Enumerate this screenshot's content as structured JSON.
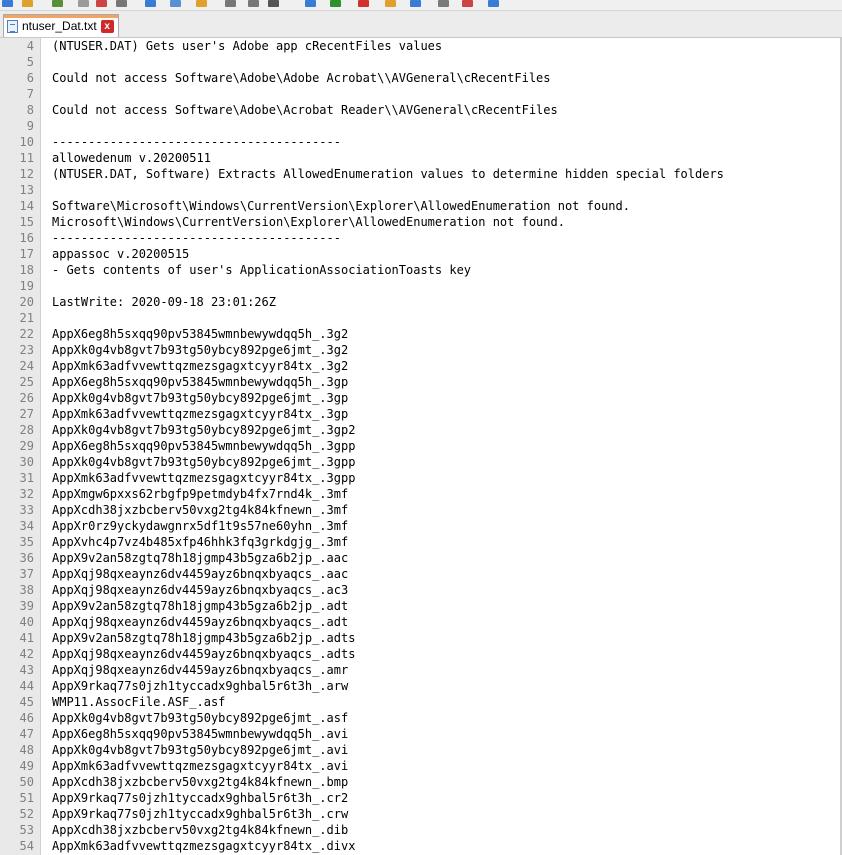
{
  "tab": {
    "label": "ntuser_Dat.txt",
    "close": "x"
  },
  "toolbar_icons": [
    "new-file-icon",
    "open-file-icon",
    "save-icon",
    "save-all-icon",
    "close-icon",
    "print-icon",
    "cut-icon",
    "copy-icon",
    "paste-icon",
    "undo-icon",
    "redo-icon",
    "find-icon",
    "replace-icon",
    "zoom-in-icon",
    "zoom-out-icon",
    "sync-icon",
    "wrap-icon",
    "indent-icon",
    "macro-record-icon",
    "macro-play-icon"
  ],
  "lines": [
    {
      "n": "4",
      "t": "(NTUSER.DAT) Gets user's Adobe app cRecentFiles values"
    },
    {
      "n": "5",
      "t": ""
    },
    {
      "n": "6",
      "t": "Could not access Software\\Adobe\\Adobe Acrobat\\\\AVGeneral\\cRecentFiles"
    },
    {
      "n": "7",
      "t": ""
    },
    {
      "n": "8",
      "t": "Could not access Software\\Adobe\\Acrobat Reader\\\\AVGeneral\\cRecentFiles"
    },
    {
      "n": "9",
      "t": ""
    },
    {
      "n": "10",
      "t": "----------------------------------------"
    },
    {
      "n": "11",
      "t": "allowedenum v.20200511"
    },
    {
      "n": "12",
      "t": "(NTUSER.DAT, Software) Extracts AllowedEnumeration values to determine hidden special folders"
    },
    {
      "n": "13",
      "t": ""
    },
    {
      "n": "14",
      "t": "Software\\Microsoft\\Windows\\CurrentVersion\\Explorer\\AllowedEnumeration not found."
    },
    {
      "n": "15",
      "t": "Microsoft\\Windows\\CurrentVersion\\Explorer\\AllowedEnumeration not found."
    },
    {
      "n": "16",
      "t": "----------------------------------------"
    },
    {
      "n": "17",
      "t": "appassoc v.20200515"
    },
    {
      "n": "18",
      "t": "- Gets contents of user's ApplicationAssociationToasts key"
    },
    {
      "n": "19",
      "t": ""
    },
    {
      "n": "20",
      "t": "LastWrite: 2020-09-18 23:01:26Z"
    },
    {
      "n": "21",
      "t": ""
    },
    {
      "n": "22",
      "t": "AppX6eg8h5sxqq90pv53845wmnbewywdqq5h_.3g2"
    },
    {
      "n": "23",
      "t": "AppXk0g4vb8gvt7b93tg50ybcy892pge6jmt_.3g2"
    },
    {
      "n": "24",
      "t": "AppXmk63adfvvewttqzmezsgagxtcyyr84tx_.3g2"
    },
    {
      "n": "25",
      "t": "AppX6eg8h5sxqq90pv53845wmnbewywdqq5h_.3gp"
    },
    {
      "n": "26",
      "t": "AppXk0g4vb8gvt7b93tg50ybcy892pge6jmt_.3gp"
    },
    {
      "n": "27",
      "t": "AppXmk63adfvvewttqzmezsgagxtcyyr84tx_.3gp"
    },
    {
      "n": "28",
      "t": "AppXk0g4vb8gvt7b93tg50ybcy892pge6jmt_.3gp2"
    },
    {
      "n": "29",
      "t": "AppX6eg8h5sxqq90pv53845wmnbewywdqq5h_.3gpp"
    },
    {
      "n": "30",
      "t": "AppXk0g4vb8gvt7b93tg50ybcy892pge6jmt_.3gpp"
    },
    {
      "n": "31",
      "t": "AppXmk63adfvvewttqzmezsgagxtcyyr84tx_.3gpp"
    },
    {
      "n": "32",
      "t": "AppXmgw6pxxs62rbgfp9petmdyb4fx7rnd4k_.3mf"
    },
    {
      "n": "33",
      "t": "AppXcdh38jxzbcberv50vxg2tg4k84kfnewn_.3mf"
    },
    {
      "n": "34",
      "t": "AppXr0rz9yckydawgnrx5df1t9s57ne60yhn_.3mf"
    },
    {
      "n": "35",
      "t": "AppXvhc4p7vz4b485xfp46hhk3fq3grkdgjg_.3mf"
    },
    {
      "n": "36",
      "t": "AppX9v2an58zgtq78h18jgmp43b5gza6b2jp_.aac"
    },
    {
      "n": "37",
      "t": "AppXqj98qxeaynz6dv4459ayz6bnqxbyaqcs_.aac"
    },
    {
      "n": "38",
      "t": "AppXqj98qxeaynz6dv4459ayz6bnqxbyaqcs_.ac3"
    },
    {
      "n": "39",
      "t": "AppX9v2an58zgtq78h18jgmp43b5gza6b2jp_.adt"
    },
    {
      "n": "40",
      "t": "AppXqj98qxeaynz6dv4459ayz6bnqxbyaqcs_.adt"
    },
    {
      "n": "41",
      "t": "AppX9v2an58zgtq78h18jgmp43b5gza6b2jp_.adts"
    },
    {
      "n": "42",
      "t": "AppXqj98qxeaynz6dv4459ayz6bnqxbyaqcs_.adts"
    },
    {
      "n": "43",
      "t": "AppXqj98qxeaynz6dv4459ayz6bnqxbyaqcs_.amr"
    },
    {
      "n": "44",
      "t": "AppX9rkaq77s0jzh1tyccadx9ghbal5r6t3h_.arw"
    },
    {
      "n": "45",
      "t": "WMP11.AssocFile.ASF_.asf"
    },
    {
      "n": "46",
      "t": "AppXk0g4vb8gvt7b93tg50ybcy892pge6jmt_.asf"
    },
    {
      "n": "47",
      "t": "AppX6eg8h5sxqq90pv53845wmnbewywdqq5h_.avi"
    },
    {
      "n": "48",
      "t": "AppXk0g4vb8gvt7b93tg50ybcy892pge6jmt_.avi"
    },
    {
      "n": "49",
      "t": "AppXmk63adfvvewttqzmezsgagxtcyyr84tx_.avi"
    },
    {
      "n": "50",
      "t": "AppXcdh38jxzbcberv50vxg2tg4k84kfnewn_.bmp"
    },
    {
      "n": "51",
      "t": "AppX9rkaq77s0jzh1tyccadx9ghbal5r6t3h_.cr2"
    },
    {
      "n": "52",
      "t": "AppX9rkaq77s0jzh1tyccadx9ghbal5r6t3h_.crw"
    },
    {
      "n": "53",
      "t": "AppXcdh38jxzbcberv50vxg2tg4k84kfnewn_.dib"
    },
    {
      "n": "54",
      "t": "AppXmk63adfvvewttqzmezsgagxtcyyr84tx_.divx"
    }
  ]
}
